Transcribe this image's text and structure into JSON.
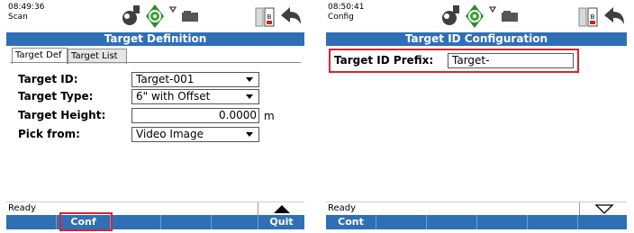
{
  "left": {
    "time": "08:49:36",
    "mode": "Scan",
    "title": "Target Definition",
    "tabs": [
      "Target Def",
      "Target List"
    ],
    "fields": {
      "target_id": {
        "label": "Target ID:",
        "value": "Target-001"
      },
      "target_type": {
        "label": "Target Type:",
        "value": "6\" with Offset"
      },
      "target_height": {
        "label": "Target Height:",
        "value": "0.0000",
        "unit": "m"
      },
      "pick_from": {
        "label": "Pick from:",
        "value": "Video Image"
      }
    },
    "status": "Ready",
    "softkeys": [
      "Conf",
      "",
      "",
      "",
      "",
      "Quit"
    ]
  },
  "right": {
    "time": "08:50:41",
    "mode": "Config",
    "title": "Target ID Configuration",
    "prefix": {
      "label": "Target ID Prefix:",
      "value": "Target-"
    },
    "status": "Ready",
    "softkeys": [
      "Cont",
      "",
      "",
      "",
      "",
      ""
    ]
  },
  "colors": {
    "title_bar": "#2f6fb6",
    "highlight": "#d6252f"
  },
  "icons": [
    "satellite-icon",
    "level-bubble-icon",
    "prism-icon",
    "battery-icon",
    "back-arrow-icon",
    "scroll-up-icon",
    "scroll-down-icon"
  ]
}
